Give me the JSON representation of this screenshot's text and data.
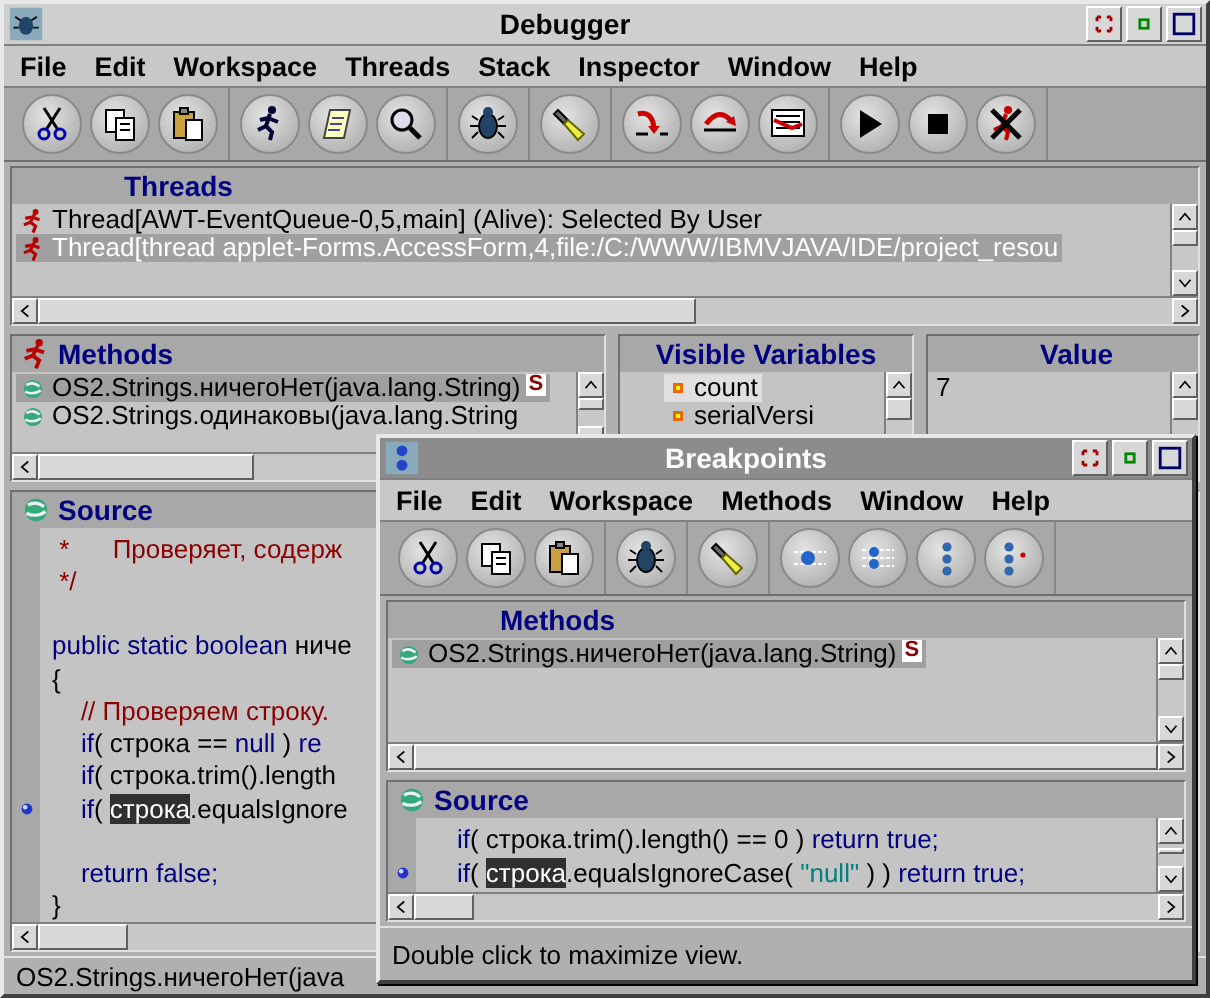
{
  "debugger": {
    "title": "Debugger",
    "menu": [
      "File",
      "Edit",
      "Workspace",
      "Threads",
      "Stack",
      "Inspector",
      "Window",
      "Help"
    ],
    "threads": {
      "header": "Threads",
      "rows": [
        {
          "text": "Thread[AWT-EventQueue-0,5,main] (Alive): Selected By User",
          "selected": false
        },
        {
          "text": "Thread[thread applet-Forms.AccessForm,4,file:/C:/WWW/IBMVJAVA/IDE/project_resou",
          "selected": true
        }
      ]
    },
    "methods": {
      "header": "Methods",
      "rows": [
        {
          "text": "OS2.Strings.ничегоНет(java.lang.String)",
          "badge": "S",
          "selected": true
        },
        {
          "text": "OS2.Strings.одинаковы(java.lang.String",
          "selected": false
        }
      ]
    },
    "variables": {
      "header": "Visible Variables",
      "rows": [
        {
          "name": "count",
          "selected": true
        },
        {
          "name": "serialVersi",
          "selected": false
        }
      ]
    },
    "value": {
      "header": "Value",
      "text": "7"
    },
    "source": {
      "header": "Source",
      "lines": [
        {
          "breakpoint": false,
          "tokens": [
            {
              "kind": "comment",
              "text": " *      Проверяет, содерж"
            }
          ]
        },
        {
          "breakpoint": false,
          "tokens": [
            {
              "kind": "comment",
              "text": " */"
            }
          ]
        },
        {
          "kind": "blank"
        },
        {
          "breakpoint": false,
          "tokens": [
            {
              "kind": "keyword",
              "text": "public static boolean "
            },
            {
              "kind": "plain",
              "text": "ниче"
            }
          ]
        },
        {
          "breakpoint": false,
          "tokens": [
            {
              "kind": "plain",
              "text": "{"
            }
          ]
        },
        {
          "breakpoint": false,
          "tokens": [
            {
              "kind": "comment",
              "text": "    // Проверяем строку."
            }
          ]
        },
        {
          "breakpoint": false,
          "tokens": [
            {
              "kind": "keyword",
              "text": "    if"
            },
            {
              "kind": "plain",
              "text": "( строка == "
            },
            {
              "kind": "keyword",
              "text": "null"
            },
            {
              "kind": "plain",
              "text": " ) "
            },
            {
              "kind": "keyword",
              "text": "re"
            }
          ]
        },
        {
          "breakpoint": false,
          "tokens": [
            {
              "kind": "keyword",
              "text": "    if"
            },
            {
              "kind": "plain",
              "text": "( строка.trim().length"
            }
          ]
        },
        {
          "breakpoint": true,
          "tokens": [
            {
              "kind": "keyword",
              "text": "    if"
            },
            {
              "kind": "plain",
              "text": "( "
            },
            {
              "kind": "highlight",
              "text": "строка"
            },
            {
              "kind": "plain",
              "text": ".equalsIgnore"
            }
          ]
        },
        {
          "kind": "blank"
        },
        {
          "breakpoint": false,
          "tokens": [
            {
              "kind": "keyword",
              "text": "    return false;"
            }
          ]
        },
        {
          "breakpoint": false,
          "tokens": [
            {
              "kind": "plain",
              "text": "}"
            }
          ]
        }
      ]
    },
    "status_bar": "OS2.Strings.ничегоНет(java"
  },
  "breakpoints": {
    "title": "Breakpoints",
    "menu": [
      "File",
      "Edit",
      "Workspace",
      "Methods",
      "Window",
      "Help"
    ],
    "methods": {
      "header": "Methods",
      "rows": [
        {
          "text": "OS2.Strings.ничегоНет(java.lang.String)",
          "badge": "S",
          "selected": true
        }
      ]
    },
    "source": {
      "header": "Source",
      "lines": [
        {
          "breakpoint": false,
          "tokens": [
            {
              "kind": "keyword",
              "text": "    if"
            },
            {
              "kind": "plain",
              "text": "( строка.trim().length() == 0 ) "
            },
            {
              "kind": "keyword",
              "text": "return true;"
            }
          ]
        },
        {
          "breakpoint": true,
          "tokens": [
            {
              "kind": "keyword",
              "text": "    if"
            },
            {
              "kind": "plain",
              "text": "( "
            },
            {
              "kind": "highlight",
              "text": "строка"
            },
            {
              "kind": "plain",
              "text": ".equalsIgnoreCase( "
            },
            {
              "kind": "string",
              "text": "\"null\""
            },
            {
              "kind": "plain",
              "text": " ) ) "
            },
            {
              "kind": "keyword",
              "text": "return true;"
            }
          ]
        }
      ]
    },
    "status_bar": "Double click to maximize view."
  }
}
